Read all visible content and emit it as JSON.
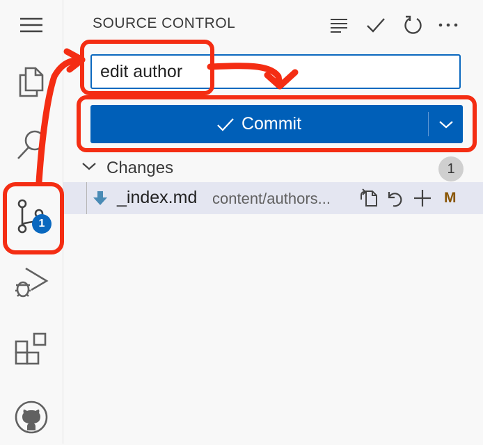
{
  "activity_bar": {
    "items": [
      "menu",
      "explorer",
      "search",
      "source-control",
      "run-and-debug",
      "extensions",
      "github"
    ],
    "scm_badge": "1"
  },
  "panel": {
    "title": "SOURCE CONTROL",
    "toolbar": [
      "view-as-tree",
      "commit",
      "refresh",
      "more-actions"
    ]
  },
  "commit_message": {
    "value": "edit author"
  },
  "commit_button": {
    "label": "Commit"
  },
  "changes": {
    "label": "Changes",
    "count": "1",
    "files": [
      {
        "name": "_index.md",
        "path": "content/authors...",
        "status": "M"
      }
    ]
  },
  "colors": {
    "accent": "#005fb8",
    "annotation": "#f42d13",
    "badge": "#0a68bf",
    "modified": "#895503"
  }
}
